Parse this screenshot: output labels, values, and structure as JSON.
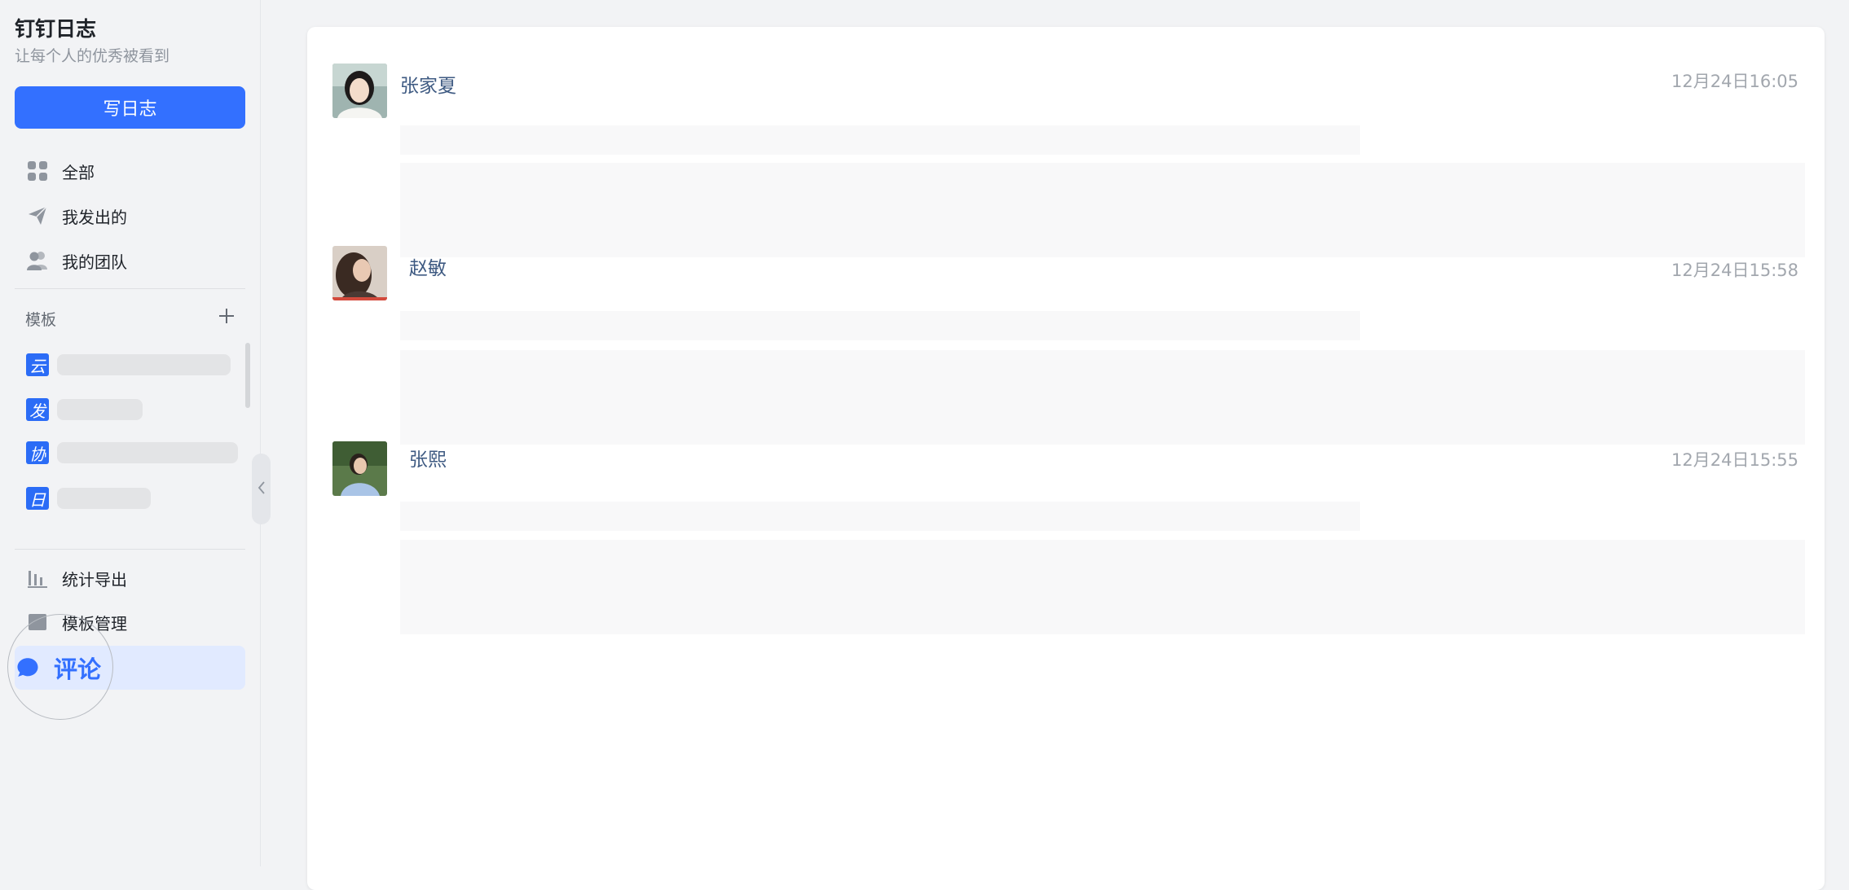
{
  "app": {
    "title": "钉钉日志",
    "subtitle": "让每个人的优秀被看到",
    "write_button": "写日志"
  },
  "nav": {
    "all": "全部",
    "sent": "我发出的",
    "team": "我的团队",
    "stats": "统计导出",
    "manage": "模板管理",
    "comment": "评论"
  },
  "templates": {
    "label": "模板",
    "items": [
      {
        "badge": "云"
      },
      {
        "badge": "发"
      },
      {
        "badge": "协"
      },
      {
        "badge": "日"
      }
    ]
  },
  "logs": [
    {
      "author": "张家夏",
      "time": "12月24日16:05"
    },
    {
      "author": "赵敏",
      "time": "12月24日15:58"
    },
    {
      "author": "张熙",
      "time": "12月24日15:55"
    }
  ],
  "colors": {
    "accent": "#3370ff",
    "badge": "#2b6cf6",
    "author": "#3e5a82"
  }
}
